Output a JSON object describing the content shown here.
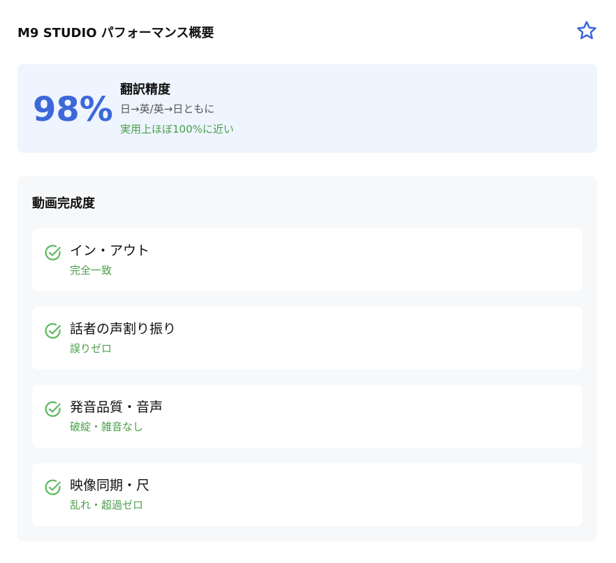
{
  "header": {
    "title": "M9 STUDIO パフォーマンス概要",
    "favorite_icon": "star-outline-icon",
    "accent_color": "#3d68d9"
  },
  "accuracy": {
    "value": "98%",
    "label": "翻訳精度",
    "description": "日→英/英→日ともに",
    "note": "実用上ほぼ100%に近い"
  },
  "completion": {
    "title": "動画完成度",
    "check_icon": "check-circle-icon",
    "success_color": "#4a9e4a",
    "items": [
      {
        "label": "イン・アウト",
        "status": "完全一致"
      },
      {
        "label": "話者の声割り振り",
        "status": "誤りゼロ"
      },
      {
        "label": "発音品質・音声",
        "status": "破綻・雑音なし"
      },
      {
        "label": "映像同期・尺",
        "status": "乱れ・超過ゼロ"
      }
    ]
  }
}
